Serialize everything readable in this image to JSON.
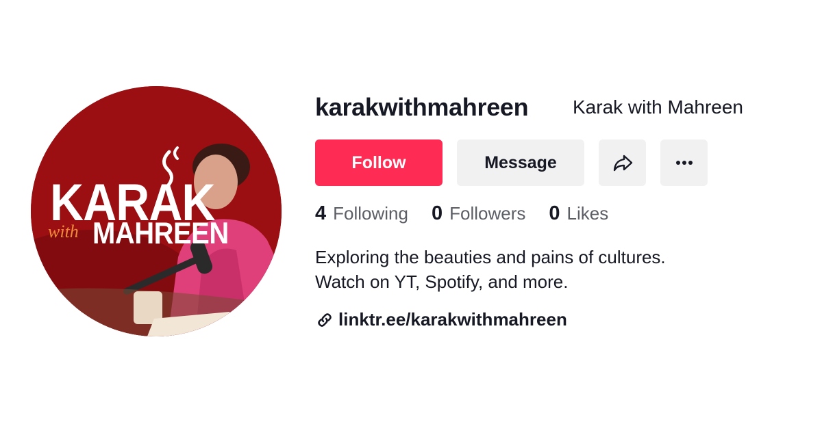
{
  "profile": {
    "username": "karakwithmahreen",
    "nickname": "Karak with Mahreen",
    "avatar": {
      "title": "KARAK",
      "with_text": "with",
      "subtitle": "MAHREEN",
      "background_color": "#9b0f12",
      "accent_color": "#f08a3c"
    }
  },
  "actions": {
    "follow_label": "Follow",
    "message_label": "Message",
    "share_icon": "share-arrow-icon",
    "more_icon": "more-horizontal-icon"
  },
  "stats": {
    "following": {
      "count": "4",
      "label": "Following"
    },
    "followers": {
      "count": "0",
      "label": "Followers"
    },
    "likes": {
      "count": "0",
      "label": "Likes"
    }
  },
  "bio": {
    "line1": "Exploring the beauties and pains of cultures.",
    "line2": "Watch on YT, Spotify, and more."
  },
  "link": {
    "icon": "link-icon",
    "text": "linktr.ee/karakwithmahreen"
  },
  "colors": {
    "primary": "#fe2c55",
    "secondary_button": "#f1f1f2",
    "text": "#161823",
    "muted_text": "#5c5e66"
  }
}
